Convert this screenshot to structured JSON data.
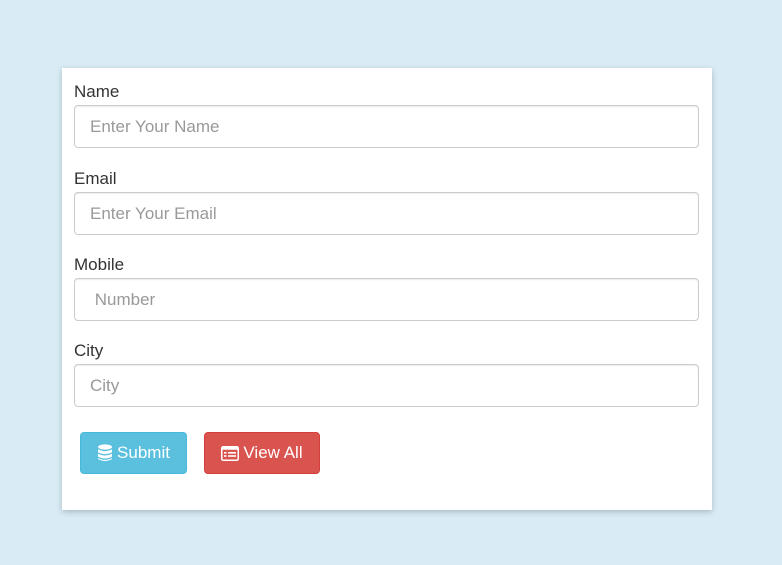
{
  "form": {
    "fields": [
      {
        "label": "Name",
        "placeholder": "Enter Your Name",
        "value": ""
      },
      {
        "label": "Email",
        "placeholder": "Enter Your Email",
        "value": ""
      },
      {
        "label": "Mobile",
        "placeholder": " Number",
        "value": ""
      },
      {
        "label": "City",
        "placeholder": "City",
        "value": ""
      }
    ],
    "buttons": {
      "submit": {
        "label": "Submit",
        "icon": "database-icon",
        "color": "#5bc0de"
      },
      "view_all": {
        "label": "View All",
        "icon": "list-icon",
        "color": "#d9534f"
      }
    }
  },
  "colors": {
    "page_bg": "#d9ecf5",
    "card_bg": "#ffffff"
  }
}
